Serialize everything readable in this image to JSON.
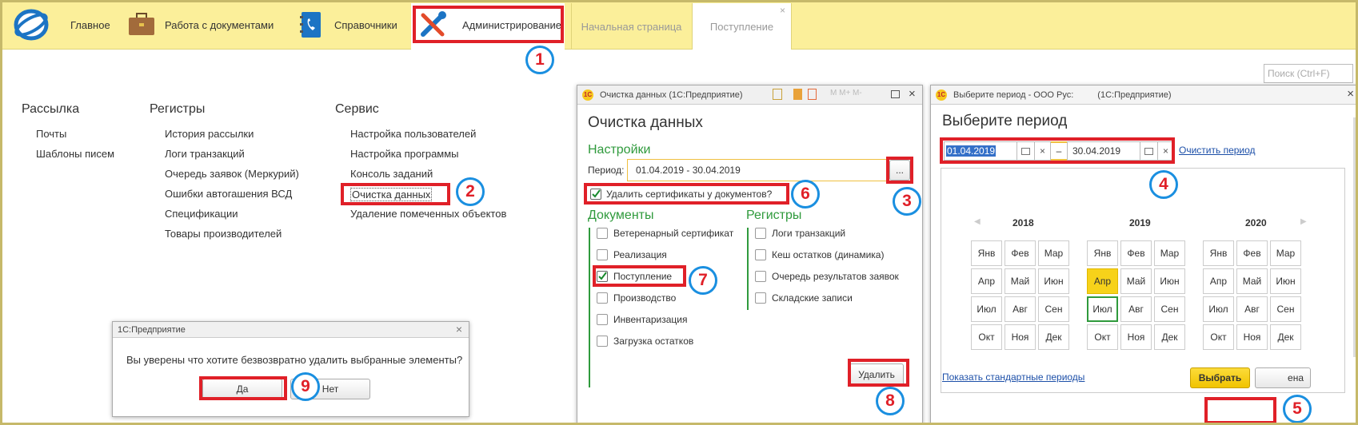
{
  "topbar": {
    "sections": [
      "Главное",
      "Работа с документами",
      "Справочники",
      "Администрирование"
    ],
    "tabs": [
      "Начальная страница",
      "Поступление"
    ],
    "tab_close": "×"
  },
  "search": {
    "placeholder": "Поиск (Ctrl+F)"
  },
  "main": {
    "groups": [
      {
        "title": "Рассылка",
        "items": [
          "Почты",
          "Шаблоны писем"
        ]
      },
      {
        "title": "Регистры",
        "items": [
          "История рассылки",
          "Логи транзакций",
          "Очередь заявок (Меркурий)",
          "Ошибки автогашения ВСД",
          "Спецификации",
          "Товары производителей"
        ]
      },
      {
        "title": "Сервис",
        "items": [
          "Настройка пользователей",
          "Настройка программы",
          "Консоль заданий",
          "Очистка данных",
          "Удаление помеченных объектов"
        ]
      }
    ]
  },
  "confirm_dialog": {
    "title": "1С:Предприятие",
    "message": "Вы уверены что хотите безвозвратно удалить выбранные элементы?",
    "yes": "Да",
    "no": "Нет",
    "close": "×"
  },
  "cleanup": {
    "window_title": "Очистка данных (1С:Предприятие)",
    "title_icons": "M M+ M-",
    "heading": "Очистка данных",
    "settings_label": "Настройки",
    "period_label": "Период:",
    "period_value": "01.04.2019 - 30.04.2019",
    "period_button": "...",
    "delete_certs_label": "Удалить сертификаты у документов?",
    "documents_label": "Документы",
    "registers_label": "Регистры",
    "documents": [
      {
        "label": "Ветеренарный сертификат",
        "checked": false
      },
      {
        "label": "Реализация",
        "checked": false
      },
      {
        "label": "Поступление",
        "checked": true
      },
      {
        "label": "Производство",
        "checked": false
      },
      {
        "label": "Инвентаризация",
        "checked": false
      },
      {
        "label": "Загрузка остатков",
        "checked": false
      }
    ],
    "registers": [
      {
        "label": "Логи транзакций",
        "checked": false
      },
      {
        "label": "Кеш остатков (динамика)",
        "checked": false
      },
      {
        "label": "Очередь результатов заявок",
        "checked": false
      },
      {
        "label": "Складские записи",
        "checked": false
      }
    ],
    "delete_button": "Удалить"
  },
  "period_window": {
    "window_title": "Выберите период - ООО Рус:",
    "window_app": "(1С:Предприятие)",
    "heading": "Выберите период",
    "date_from": "01.04.2019",
    "date_to": "30.04.2019",
    "dash": "–",
    "clear_x": "×",
    "clear_link": "Очистить период",
    "years": [
      "2018",
      "2019",
      "2020"
    ],
    "months": [
      "Янв",
      "Фев",
      "Мар",
      "Апр",
      "Май",
      "Июн",
      "Июл",
      "Авг",
      "Сен",
      "Окт",
      "Ноя",
      "Дек"
    ],
    "selected_year": "2019",
    "selected_month": "Апр",
    "show_standard": "Показать стандартные периоды",
    "select_button": "Выбрать",
    "cancel_partial": "ена"
  },
  "markers": [
    "1",
    "2",
    "3",
    "4",
    "5",
    "6",
    "7",
    "8",
    "9"
  ],
  "colors": {
    "topbar": "#fbef9a",
    "accent_green": "#2f9a3c",
    "highlight_red": "#e02028",
    "marker_blue": "#1a8fe0",
    "selected_month": "#f7d21a"
  }
}
